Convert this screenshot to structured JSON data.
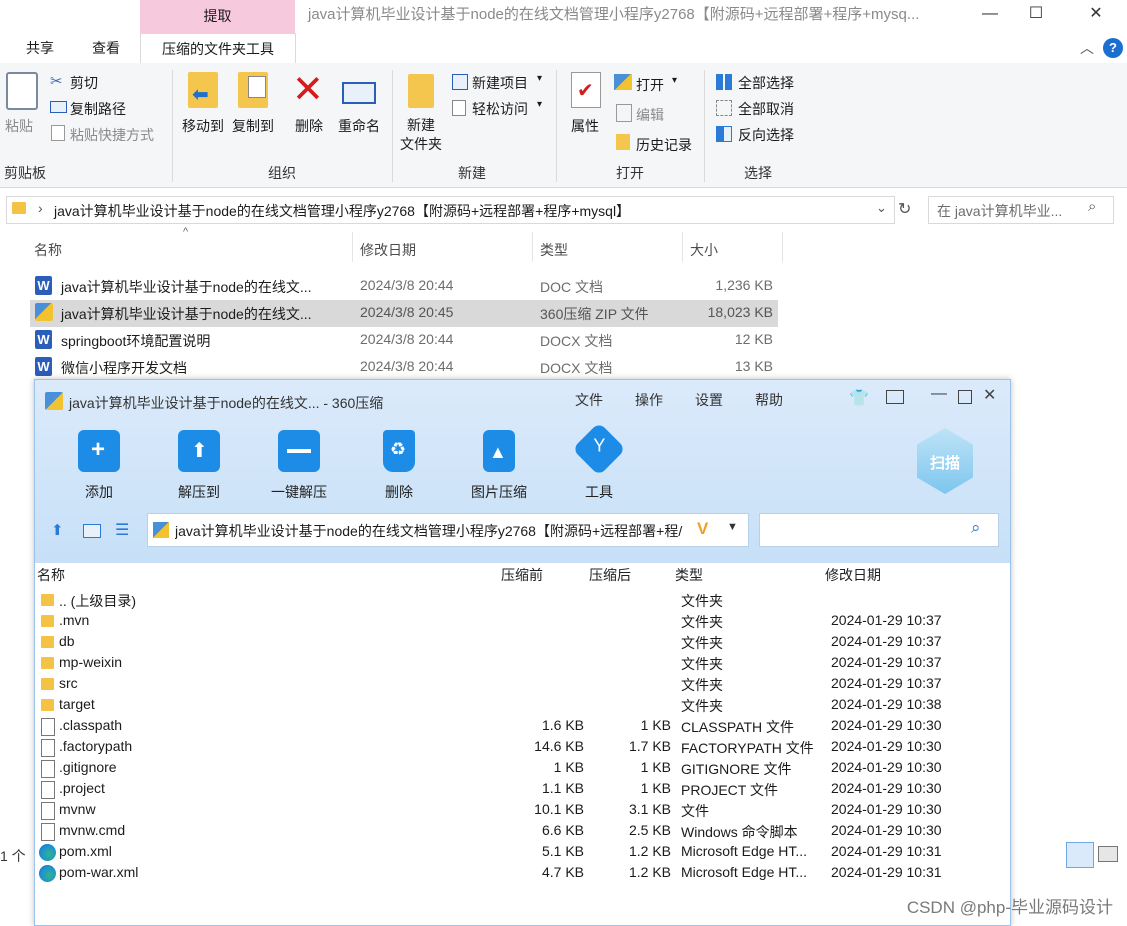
{
  "explorer": {
    "context_tab": "提取",
    "window_title": "java计算机毕业设计基于node的在线文档管理小程序y2768【附源码+远程部署+程序+mysq...",
    "tabs": [
      "共享",
      "查看",
      "压缩的文件夹工具"
    ],
    "ribbon": {
      "paste": "粘贴",
      "cut": "剪切",
      "copy_path": "复制路径",
      "paste_shortcut": "粘贴快捷方式",
      "clipboard_group": "剪贴板",
      "move_to": "移动到",
      "copy_to": "复制到",
      "delete": "删除",
      "rename": "重命名",
      "organize_group": "组织",
      "new_folder": "新建\n文件夹",
      "new_item": "新建项目",
      "easy_access": "轻松访问",
      "new_group": "新建",
      "properties": "属性",
      "open": "打开",
      "edit": "编辑",
      "history": "历史记录",
      "open_group": "打开",
      "select_all": "全部选择",
      "select_none": "全部取消",
      "invert_selection": "反向选择",
      "select_group": "选择"
    },
    "address": "java计算机毕业设计基于node的在线文档管理小程序y2768【附源码+远程部署+程序+mysql】",
    "search_placeholder": "在 java计算机毕业...",
    "columns": [
      "名称",
      "修改日期",
      "类型",
      "大小"
    ],
    "files": [
      {
        "name": "java计算机毕业设计基于node的在线文...",
        "date": "2024/3/8 20:44",
        "type": "DOC 文档",
        "size": "1,236 KB",
        "icon": "word-icon"
      },
      {
        "name": "java计算机毕业设计基于node的在线文...",
        "date": "2024/3/8 20:45",
        "type": "360压缩 ZIP 文件",
        "size": "18,023 KB",
        "icon": "zip-icon"
      },
      {
        "name": "springboot环境配置说明",
        "date": "2024/3/8 20:44",
        "type": "DOCX 文档",
        "size": "12 KB",
        "icon": "word-icon"
      },
      {
        "name": "微信小程序开发文档",
        "date": "2024/3/8 20:44",
        "type": "DOCX 文档",
        "size": "13 KB",
        "icon": "word-icon"
      }
    ],
    "status_count": "1 个"
  },
  "zip": {
    "title": "java计算机毕业设计基于node的在线文... - 360压缩",
    "menu": [
      "文件",
      "操作",
      "设置",
      "帮助"
    ],
    "toolbar": [
      "添加",
      "解压到",
      "一键解压",
      "删除",
      "图片压缩",
      "工具"
    ],
    "scan_label": "扫描",
    "path": "java计算机毕业设计基于node的在线文档管理小程序y2768【附源码+远程部署+程/",
    "columns": [
      "名称",
      "压缩前",
      "压缩后",
      "类型",
      "修改日期"
    ],
    "rows": [
      {
        "name": ".. (上级目录)",
        "before": "",
        "after": "",
        "type": "文件夹",
        "date": "",
        "icon": "folder"
      },
      {
        "name": ".mvn",
        "before": "",
        "after": "",
        "type": "文件夹",
        "date": "2024-01-29 10:37",
        "icon": "folder"
      },
      {
        "name": "db",
        "before": "",
        "after": "",
        "type": "文件夹",
        "date": "2024-01-29 10:37",
        "icon": "folder"
      },
      {
        "name": "mp-weixin",
        "before": "",
        "after": "",
        "type": "文件夹",
        "date": "2024-01-29 10:37",
        "icon": "folder"
      },
      {
        "name": "src",
        "before": "",
        "after": "",
        "type": "文件夹",
        "date": "2024-01-29 10:37",
        "icon": "folder"
      },
      {
        "name": "target",
        "before": "",
        "after": "",
        "type": "文件夹",
        "date": "2024-01-29 10:38",
        "icon": "folder"
      },
      {
        "name": ".classpath",
        "before": "1.6 KB",
        "after": "1 KB",
        "type": "CLASSPATH 文件",
        "date": "2024-01-29 10:30",
        "icon": "file"
      },
      {
        "name": ".factorypath",
        "before": "14.6 KB",
        "after": "1.7 KB",
        "type": "FACTORYPATH 文件",
        "date": "2024-01-29 10:30",
        "icon": "file"
      },
      {
        "name": ".gitignore",
        "before": "1 KB",
        "after": "1 KB",
        "type": "GITIGNORE 文件",
        "date": "2024-01-29 10:30",
        "icon": "file"
      },
      {
        "name": ".project",
        "before": "1.1 KB",
        "after": "1 KB",
        "type": "PROJECT 文件",
        "date": "2024-01-29 10:30",
        "icon": "file"
      },
      {
        "name": "mvnw",
        "before": "10.1 KB",
        "after": "3.1 KB",
        "type": "文件",
        "date": "2024-01-29 10:30",
        "icon": "file"
      },
      {
        "name": "mvnw.cmd",
        "before": "6.6 KB",
        "after": "2.5 KB",
        "type": "Windows 命令脚本",
        "date": "2024-01-29 10:30",
        "icon": "file"
      },
      {
        "name": "pom.xml",
        "before": "5.1 KB",
        "after": "1.2 KB",
        "type": "Microsoft Edge HT...",
        "date": "2024-01-29 10:31",
        "icon": "edge"
      },
      {
        "name": "pom-war.xml",
        "before": "4.7 KB",
        "after": "1.2 KB",
        "type": "Microsoft Edge HT...",
        "date": "2024-01-29 10:31",
        "icon": "edge"
      }
    ]
  },
  "watermark": "CSDN @php-毕业源码设计"
}
